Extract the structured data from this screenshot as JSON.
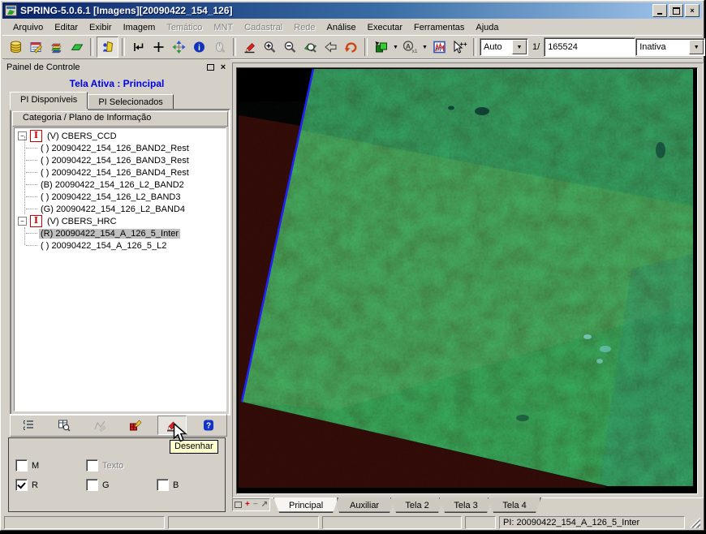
{
  "window": {
    "title": "SPRING-5.0.6.1 [Imagens][20090422_154_126]"
  },
  "icons": {
    "close": "×",
    "panel_close": "×",
    "dropdown": "▼",
    "help": "?",
    "plus_tool": "+",
    "expander_collapse": "−",
    "category_letter": "I",
    "tab_add": "+",
    "tab_remove": "−",
    "tab_detach": "↗",
    "contrast_letter": "A",
    "contrast_sub": "x1",
    "pointer_plus": "++"
  },
  "menu": {
    "items": [
      {
        "label": "Arquivo",
        "enabled": true
      },
      {
        "label": "Editar",
        "enabled": true
      },
      {
        "label": "Exibir",
        "enabled": true
      },
      {
        "label": "Imagem",
        "enabled": true
      },
      {
        "label": "Temático",
        "enabled": false
      },
      {
        "label": "MNT",
        "enabled": false
      },
      {
        "label": "Cadastral",
        "enabled": false
      },
      {
        "label": "Rede",
        "enabled": false
      },
      {
        "label": "Análise",
        "enabled": true
      },
      {
        "label": "Executar",
        "enabled": true
      },
      {
        "label": "Ferramentas",
        "enabled": true
      },
      {
        "label": "Ajuda",
        "enabled": true
      }
    ]
  },
  "toolbar": {
    "zoom_mode": "Auto",
    "scale_prefix": "1/",
    "scale_value": "165524",
    "cursor_mode": "Inativa"
  },
  "panel": {
    "title": "Painel de Controle",
    "active_screen": "Tela Ativa : Principal",
    "tabs": [
      {
        "label": "PI Disponíveis"
      },
      {
        "label": "PI Selecionados"
      }
    ],
    "tree": {
      "header": "Categoria / Plano de Informação",
      "categories": [
        {
          "label": "(V) CBERS_CCD",
          "items": [
            {
              "label": "( ) 20090422_154_126_BAND2_Rest"
            },
            {
              "label": "( ) 20090422_154_126_BAND3_Rest"
            },
            {
              "label": "( ) 20090422_154_126_BAND4_Rest"
            },
            {
              "label": "(B) 20090422_154_126_L2_BAND2"
            },
            {
              "label": "( ) 20090422_154_126_L2_BAND3"
            },
            {
              "label": "(G) 20090422_154_126_L2_BAND4"
            }
          ]
        },
        {
          "label": "(V) CBERS_HRC",
          "items": [
            {
              "label": "(R) 20090422_154_A_126_5_Inter",
              "selected": true
            },
            {
              "label": "( ) 20090422_154_A_126_5_L2"
            }
          ]
        }
      ]
    },
    "tooltip": "Desenhar",
    "checkboxes": [
      {
        "label": "M",
        "checked": false,
        "enabled": true
      },
      {
        "label": "Texto",
        "checked": false,
        "enabled": false
      },
      {
        "label": "R",
        "checked": true,
        "enabled": true
      },
      {
        "label": "G",
        "checked": false,
        "enabled": true
      },
      {
        "label": "B",
        "checked": false,
        "enabled": true
      }
    ]
  },
  "screens": {
    "tabs": [
      {
        "label": "Principal",
        "active": true
      },
      {
        "label": "Auxiliar",
        "active": false
      },
      {
        "label": "Tela 2",
        "active": false
      },
      {
        "label": "Tela 3",
        "active": false
      },
      {
        "label": "Tela 4",
        "active": false
      }
    ]
  },
  "status": {
    "pi": "PI: 20090422_154_A_126_5_Inter"
  },
  "colors": {
    "titlebar_left": "#0a246a",
    "titlebar_right": "#a6caf0",
    "accent_text": "#0000e6",
    "selection_gray": "#c0c0c0",
    "tooltip_bg": "#ffffcf",
    "canvas_black": "#000000",
    "canvas_maroon": "#300704",
    "image_green": "#1f7a28",
    "image_dark_teal": "#073c48",
    "image_olive": "#8d8a3a",
    "image_teal": "#0b4f58",
    "edge_blue": "#2020ff"
  }
}
